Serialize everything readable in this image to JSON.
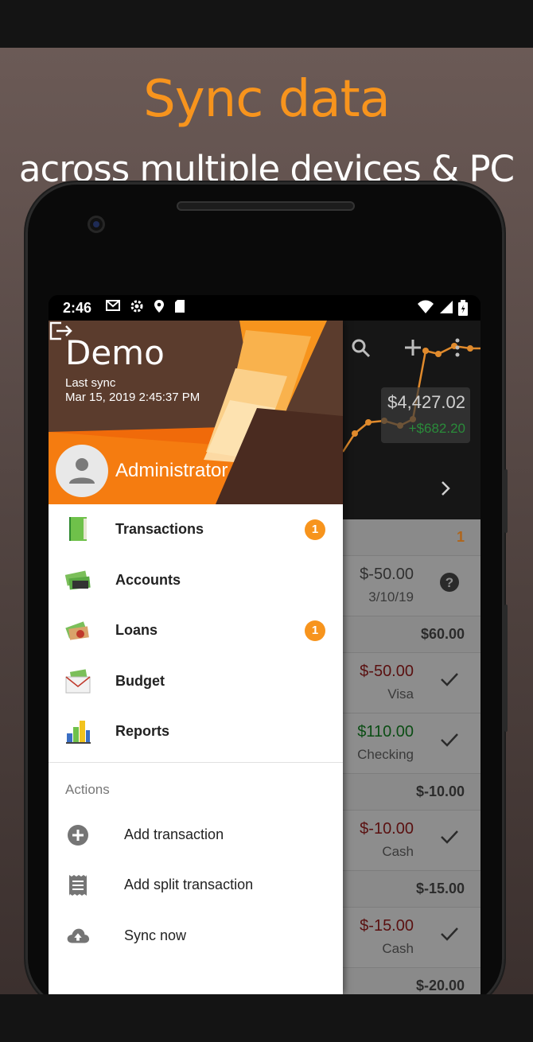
{
  "promo": {
    "headline": "Sync data",
    "subline": "across multiple devices & PC"
  },
  "statusbar": {
    "time": "2:46",
    "icons": [
      "gmail-icon",
      "gear-icon",
      "location-icon",
      "sdcard-icon"
    ],
    "right_icons": [
      "wifi-icon",
      "signal-icon",
      "battery-icon"
    ]
  },
  "drawer": {
    "app_name": "Demo",
    "last_sync_label": "Last sync",
    "last_sync_time": "Mar 15, 2019 2:45:37 PM",
    "user": "Administrator",
    "menu": [
      {
        "label": "Transactions",
        "icon": "book-icon",
        "badge": "1"
      },
      {
        "label": "Accounts",
        "icon": "money-icon",
        "badge": ""
      },
      {
        "label": "Loans",
        "icon": "loan-icon",
        "badge": "1"
      },
      {
        "label": "Budget",
        "icon": "envelope-money-icon",
        "badge": ""
      },
      {
        "label": "Reports",
        "icon": "bar-chart-icon",
        "badge": ""
      }
    ],
    "actions_label": "Actions",
    "actions": [
      {
        "label": "Add transaction",
        "icon": "plus-circle-icon"
      },
      {
        "label": "Add split transaction",
        "icon": "receipt-icon"
      },
      {
        "label": "Sync now",
        "icon": "cloud-upload-icon"
      }
    ]
  },
  "background": {
    "balance": "$4,427.02",
    "change": "+$682.20",
    "rows": [
      {
        "type": "header",
        "total": "1"
      },
      {
        "type": "row",
        "amount": "$-50.00",
        "sub": "3/10/19",
        "icon": "?"
      },
      {
        "type": "header",
        "total": "$60.00"
      },
      {
        "type": "row",
        "amount": "$-50.00",
        "sub": "Visa",
        "icon": "✓"
      },
      {
        "type": "row",
        "amount": "$110.00",
        "sub": "Checking",
        "icon": "✓"
      },
      {
        "type": "header",
        "total": "$-10.00"
      },
      {
        "type": "row",
        "amount": "$-10.00",
        "sub": "Cash",
        "icon": "✓"
      },
      {
        "type": "header",
        "total": "$-15.00"
      },
      {
        "type": "row",
        "amount": "$-15.00",
        "sub": "Cash",
        "icon": "✓"
      },
      {
        "type": "header",
        "total": "$-20.00"
      }
    ]
  },
  "colors": {
    "accent": "#f7941d",
    "header_brown": "#5a3a2c",
    "positive": "#0b4d14",
    "negative": "#5a1010"
  }
}
